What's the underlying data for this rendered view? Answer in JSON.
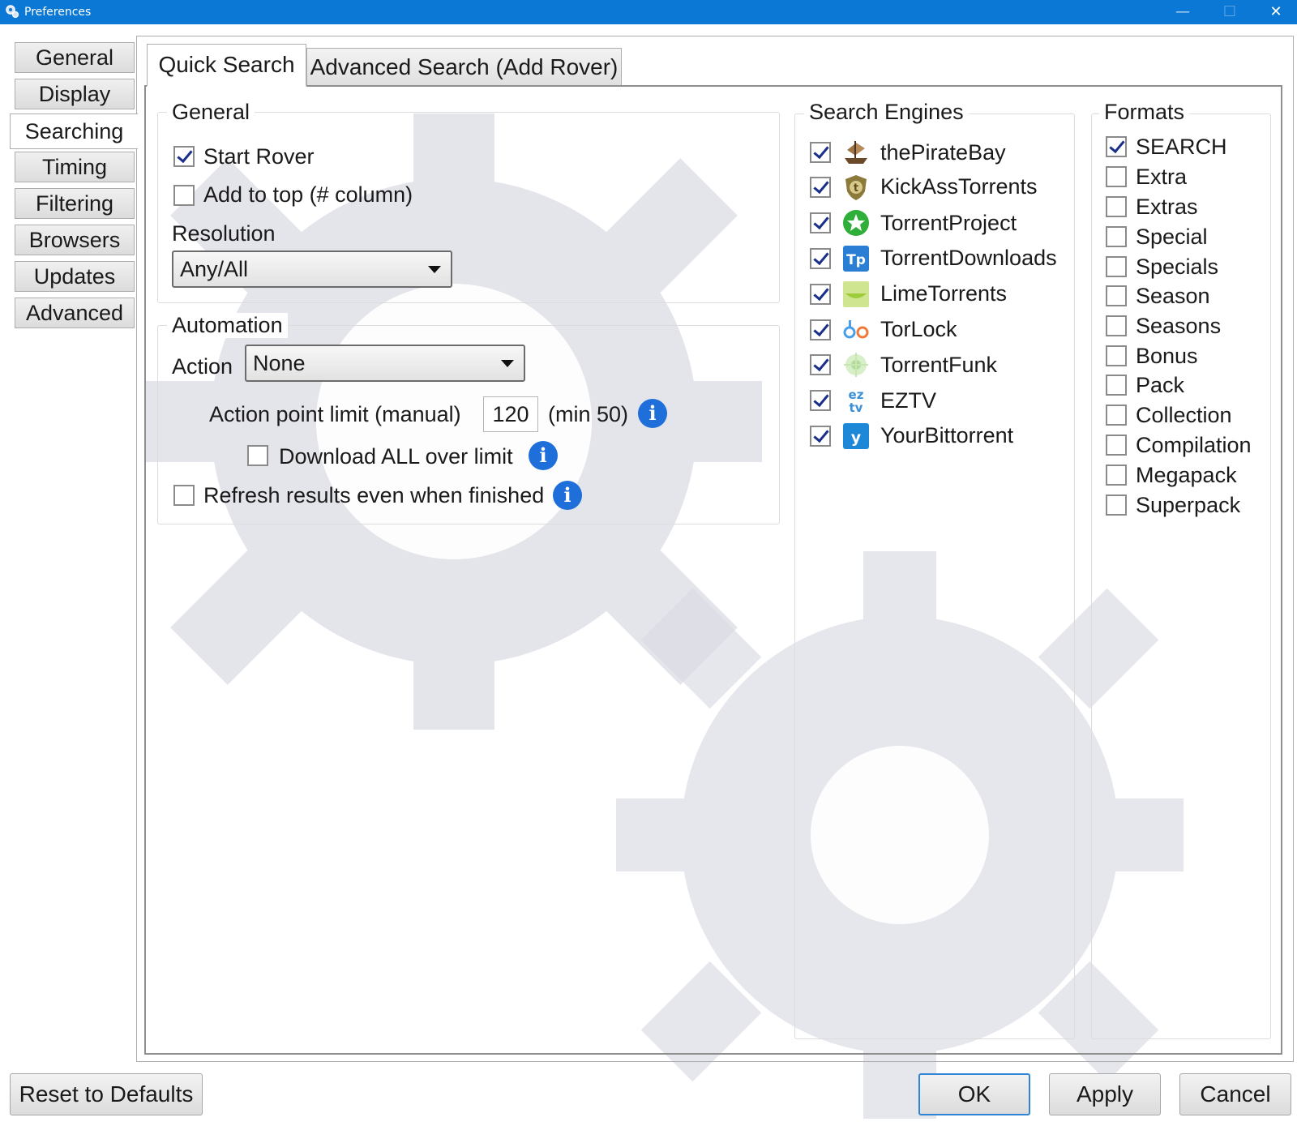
{
  "window": {
    "title": "Preferences"
  },
  "sidebar": {
    "items": [
      {
        "label": "General"
      },
      {
        "label": "Display"
      },
      {
        "label": "Searching"
      },
      {
        "label": "Timing"
      },
      {
        "label": "Filtering"
      },
      {
        "label": "Browsers"
      },
      {
        "label": "Updates"
      },
      {
        "label": "Advanced"
      }
    ],
    "active": "Searching"
  },
  "tabs": [
    {
      "label": "Quick Search"
    },
    {
      "label": "Advanced Search (Add Rover)"
    }
  ],
  "general": {
    "title": "General",
    "start_rover": {
      "label": "Start Rover",
      "checked": true
    },
    "add_to_top": {
      "label": "Add to top (# column)",
      "checked": false
    },
    "resolution_label": "Resolution",
    "resolution_value": "Any/All"
  },
  "automation": {
    "title": "Automation",
    "action_label": "Action",
    "action_value": "None",
    "limit_label": "Action point limit (manual)",
    "limit_value": "120",
    "limit_min": "(min 50)",
    "download_all": {
      "label": "Download ALL over limit",
      "checked": false
    },
    "refresh": {
      "label": "Refresh results even when finished",
      "checked": false
    }
  },
  "search_engines": {
    "title": "Search Engines",
    "items": [
      {
        "label": "thePirateBay",
        "checked": true,
        "icon": "pirate-ship-icon"
      },
      {
        "label": "KickAssTorrents",
        "checked": true,
        "icon": "kat-shield-icon"
      },
      {
        "label": "TorrentProject",
        "checked": true,
        "icon": "green-star-icon"
      },
      {
        "label": "TorrentDownloads",
        "checked": true,
        "icon": "td-logo-icon"
      },
      {
        "label": "LimeTorrents",
        "checked": true,
        "icon": "lime-icon"
      },
      {
        "label": "TorLock",
        "checked": true,
        "icon": "torlock-icon"
      },
      {
        "label": "TorrentFunk",
        "checked": true,
        "icon": "torrentfunk-icon"
      },
      {
        "label": "EZTV",
        "checked": true,
        "icon": "eztv-icon"
      },
      {
        "label": "YourBittorrent",
        "checked": true,
        "icon": "yourbittorrent-icon"
      }
    ]
  },
  "formats": {
    "title": "Formats",
    "items": [
      {
        "label": "SEARCH",
        "checked": true
      },
      {
        "label": "Extra",
        "checked": false
      },
      {
        "label": "Extras",
        "checked": false
      },
      {
        "label": "Special",
        "checked": false
      },
      {
        "label": "Specials",
        "checked": false
      },
      {
        "label": "Season",
        "checked": false
      },
      {
        "label": "Seasons",
        "checked": false
      },
      {
        "label": "Bonus",
        "checked": false
      },
      {
        "label": "Pack",
        "checked": false
      },
      {
        "label": "Collection",
        "checked": false
      },
      {
        "label": "Compilation",
        "checked": false
      },
      {
        "label": "Megapack",
        "checked": false
      },
      {
        "label": "Superpack",
        "checked": false
      }
    ]
  },
  "buttons": {
    "reset": "Reset to Defaults",
    "ok": "OK",
    "apply": "Apply",
    "cancel": "Cancel"
  },
  "colors": {
    "titlebar": "#0b78d6",
    "info_icon": "#1e6fd9",
    "check": "#1a2f8a"
  }
}
